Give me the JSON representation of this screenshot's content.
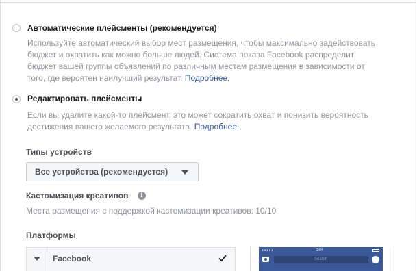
{
  "placements": {
    "automatic": {
      "title": "Автоматические плейсменты (рекомендуется)",
      "description_lines": [
        "Используйте автоматический выбор мест размещения, чтобы максимально задействовать",
        "бюджет и охватить как можно больше людей. Система показа Facebook распределит",
        "бюджет вашей группы объявлений по различным местам размещения в зависимости от",
        "того, где вероятен наилучший результат."
      ],
      "link": "Подробнее.",
      "selected": false
    },
    "edit": {
      "title": "Редактировать плейсменты",
      "description_lines": [
        "Если вы удалите какой-то плейсмент, это может сократить охват и понизить вероятность",
        "достижения вашего желаемого результата."
      ],
      "link": "Подробнее.",
      "selected": true
    }
  },
  "device_types": {
    "label": "Типы устройств",
    "selected": "Все устройства (рекомендуется)"
  },
  "creative_customization": {
    "label": "Кастомизация креативов",
    "info_icon": "info-icon",
    "text": "Места размещения с поддержкой кастомизации креативов: 10/10"
  },
  "platforms": {
    "label": "Платформы",
    "rows": [
      {
        "label": "Facebook",
        "checked": true
      }
    ]
  },
  "preview": {
    "status_time": "2:04",
    "search_placeholder": "Search"
  },
  "colors": {
    "link": "#365899",
    "muted_text": "#90949c",
    "facebook_blue": "#3b5998"
  }
}
